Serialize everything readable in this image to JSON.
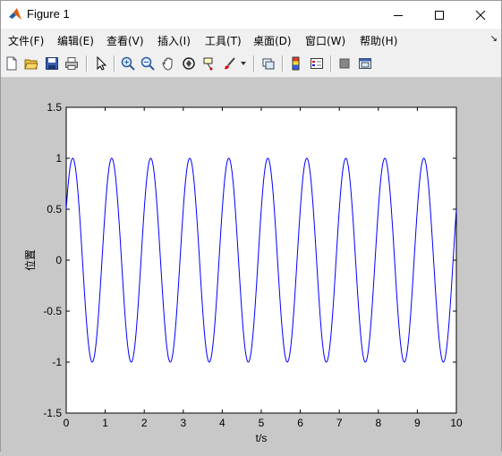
{
  "window": {
    "title": "Figure 1"
  },
  "menubar": {
    "items": [
      {
        "label": "文件(F)"
      },
      {
        "label": "编辑(E)"
      },
      {
        "label": "查看(V)"
      },
      {
        "label": "插入(I)"
      },
      {
        "label": "工具(T)"
      },
      {
        "label": "桌面(D)"
      },
      {
        "label": "窗口(W)"
      },
      {
        "label": "帮助(H)"
      }
    ]
  },
  "toolbar": {
    "icons": [
      "new-figure-icon",
      "open-file-icon",
      "save-figure-icon",
      "print-figure-icon",
      "edit-plot-icon",
      "zoom-in-icon",
      "zoom-out-icon",
      "pan-icon",
      "rotate-3d-icon",
      "data-cursor-icon",
      "brush-icon",
      "link-plot-icon",
      "insert-colorbar-icon",
      "insert-legend-icon",
      "hide-plot-tools-icon",
      "show-plot-tools-icon"
    ]
  },
  "colors": {
    "line": "#0000ff",
    "figure_bg": "#c8c8c8",
    "axes_bg": "#ffffff"
  },
  "chart_data": {
    "type": "line",
    "title": "",
    "xlabel": "t/s",
    "ylabel": "位置",
    "xlim": [
      0,
      10
    ],
    "ylim": [
      -1.5,
      1.5
    ],
    "xticks": [
      "0",
      "1",
      "2",
      "3",
      "4",
      "5",
      "6",
      "7",
      "8",
      "9",
      "10"
    ],
    "yticks": [
      "1.5",
      "1",
      "0.5",
      "0",
      "-0.5",
      "-1",
      "-1.5"
    ],
    "grid": false,
    "series": [
      {
        "function": "sin(2*pi*t + pi/6)",
        "frequency_hz": 1.0,
        "amplitude": 1.0,
        "phase_rad": 0.5236,
        "t_start": 0,
        "t_end": 10,
        "color": "#0000ff"
      }
    ]
  }
}
